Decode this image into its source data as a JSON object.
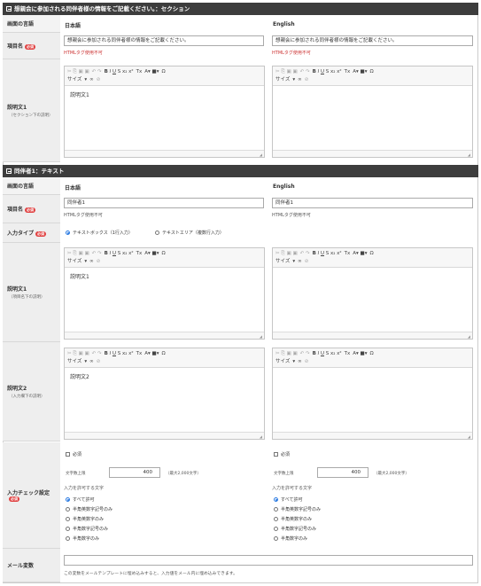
{
  "section1": {
    "title": "想親会に参加される同伴者様の情報をご記載ください。：セクション",
    "col_label": "画面の言語",
    "col_ja": "日本語",
    "col_en": "English",
    "item_label": "項目名",
    "required": "必須",
    "item_ja": "想親会に参加される同伴者様の情報をご記載ください。",
    "item_en": "想親会に参加される同伴者様の情報をご記載ください。",
    "html_note": "HTMLタグ使用不可",
    "desc_label": "説明文1",
    "desc_sub": "（セクション下の説明）",
    "desc_ja": "説明文1",
    "desc_en": ""
  },
  "section2": {
    "title": "同伴者1：テキスト",
    "item_ja": "同伴者1",
    "item_en": "同伴者1",
    "input_type_label": "入力タイプ",
    "input_opt1": "テキストボックス（1行入力）",
    "input_opt2": "テキストエリア（複数行入力）",
    "desc1_label": "説明文1",
    "desc1_sub": "（項目名下の説明）",
    "desc1_ja": "説明文1",
    "desc2_label": "説明文2",
    "desc2_sub": "（入力欄下の説明）",
    "desc2_ja": "説明文2",
    "check_label": "入力チェック設定",
    "required_chk": "必須",
    "maxlen_label": "文字数上限",
    "maxlen_value": "400",
    "maxlen_note": "（最大2,000文字）",
    "allow_label": "入力を許可する文字",
    "allow_opts": [
      "すべて許可",
      "半角英数字記号のみ",
      "半角英数字のみ",
      "半角数字記号のみ",
      "半角数字のみ"
    ],
    "mail_label": "メール変数",
    "mail_note": "この変数をメールテンプレートに埋め込みすると、入力値をメール内に埋め込みできます。"
  },
  "toolbar": {
    "size": "サイズ",
    "icons": [
      "✂",
      "⎘",
      "📋",
      "📋",
      "↶",
      "↷",
      "B",
      "I",
      "U",
      "S",
      "x₂",
      "x²",
      "Tx",
      "A",
      "A",
      "Ω"
    ]
  }
}
